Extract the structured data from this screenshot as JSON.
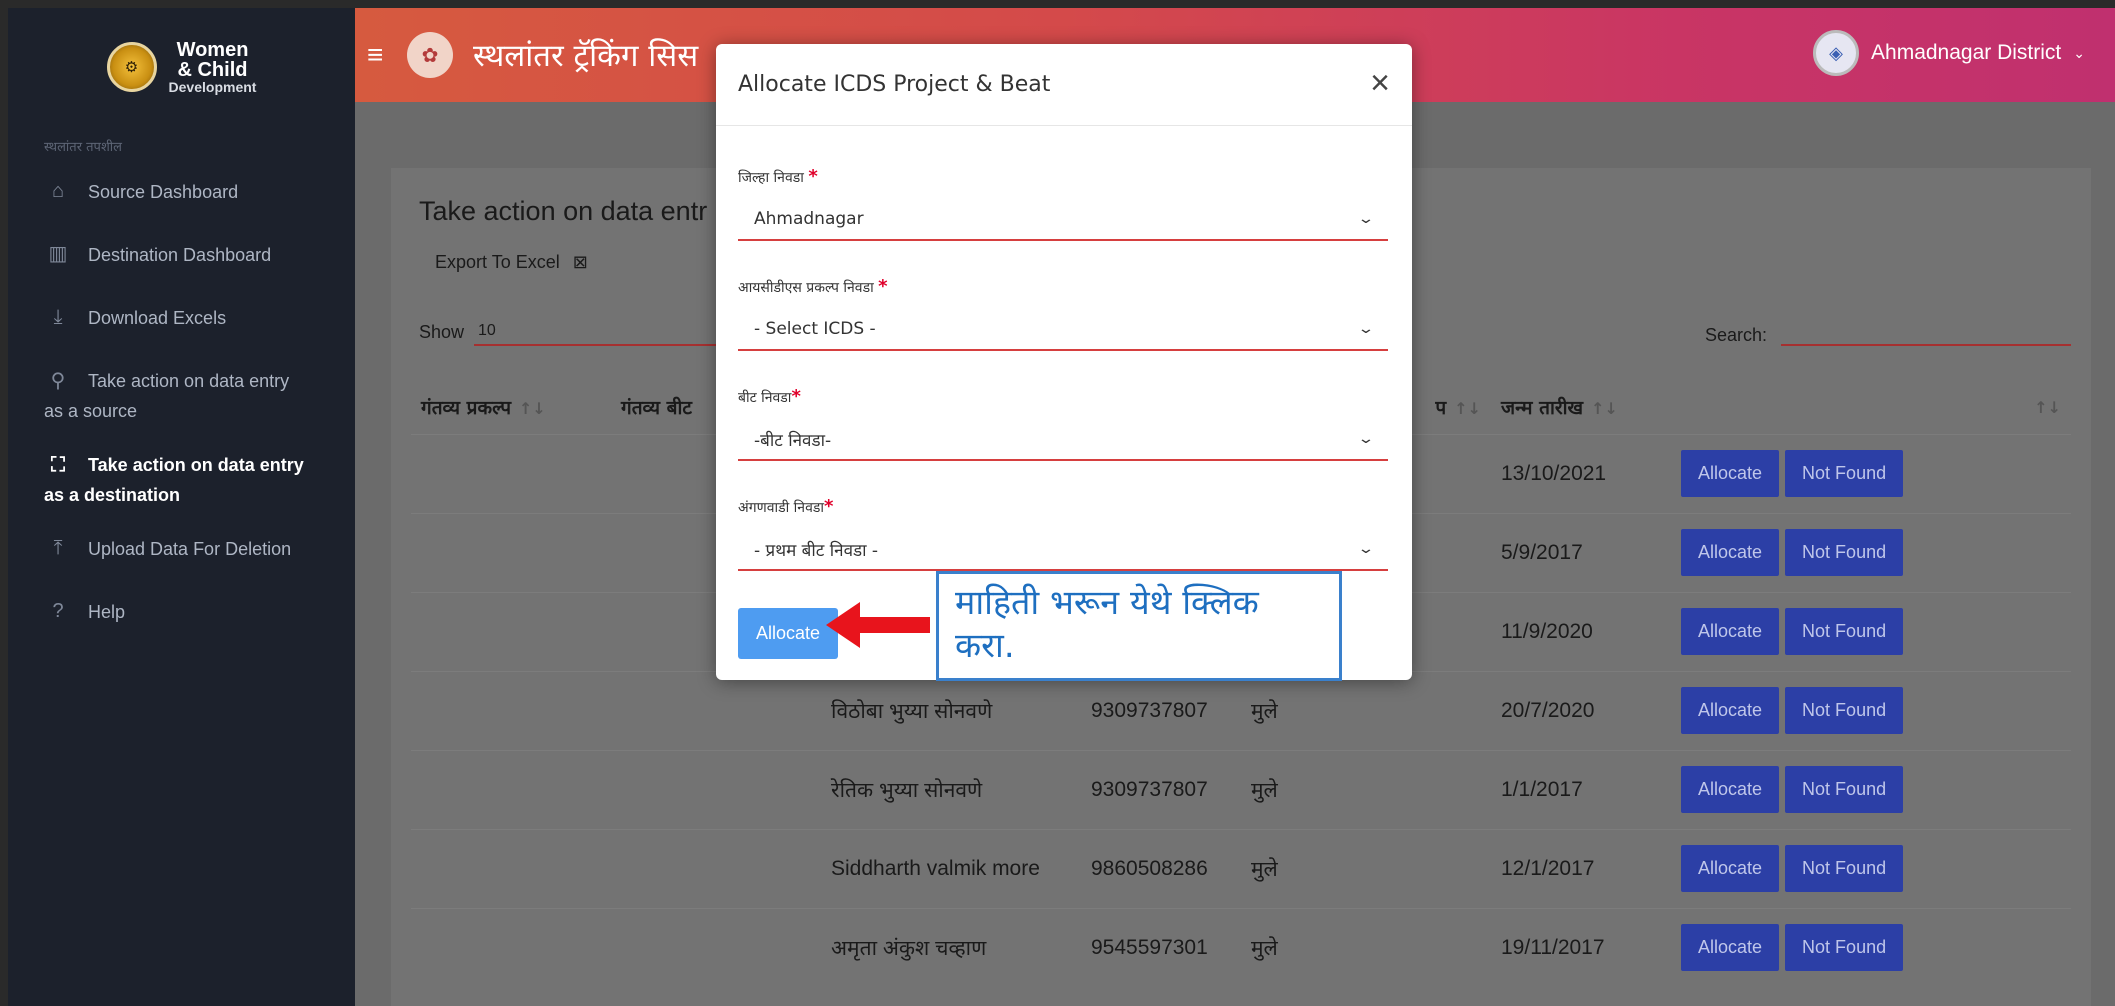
{
  "sidebar": {
    "brand": {
      "line1": "Women",
      "line2": "& Child",
      "line3": "Development"
    },
    "section_label": "स्थलांतर तपशील",
    "items": [
      {
        "label": "Source Dashboard",
        "icon": "home-icon"
      },
      {
        "label": "Destination Dashboard",
        "icon": "map-icon"
      },
      {
        "label": "Download Excels",
        "icon": "download-icon"
      },
      {
        "label": "Take action on data entry",
        "label2": "as a source",
        "icon": "user-search-icon"
      },
      {
        "label": "Take action on data entry",
        "label2": "as a destination",
        "icon": "map-search-icon",
        "active": true
      },
      {
        "label": "Upload Data For Deletion",
        "icon": "upload-icon"
      },
      {
        "label": "Help",
        "icon": "help-icon"
      }
    ]
  },
  "header": {
    "app_title": "स्थलांतर ट्रॅकिंग सिस",
    "district": "Ahmadnagar District"
  },
  "main": {
    "card_title": "Take action on data entr",
    "export_label": "Export To Excel",
    "show_label": "Show",
    "show_value": "10",
    "search_label": "Search:",
    "columns": [
      "गंतव्य प्रकल्प",
      "गंतव्य बीट",
      "प",
      "जन्म तारीख"
    ],
    "rows": [
      {
        "name": "",
        "mobile": "",
        "gender": "",
        "dob": "13/10/2021"
      },
      {
        "name": "",
        "mobile": "",
        "gender": "",
        "dob": "5/9/2017"
      },
      {
        "name": "",
        "mobile": "",
        "gender": "",
        "dob": "11/9/2020"
      },
      {
        "name": "विठोबा भुय्या सोनवणे",
        "mobile": "9309737807",
        "gender": "मुले",
        "dob": "20/7/2020"
      },
      {
        "name": "रेतिक भुय्या सोनवणे",
        "mobile": "9309737807",
        "gender": "मुले",
        "dob": "1/1/2017"
      },
      {
        "name": "Siddharth valmik more",
        "mobile": "9860508286",
        "gender": "मुले",
        "dob": "12/1/2017"
      },
      {
        "name": "अमृता अंकुश चव्हाण",
        "mobile": "9545597301",
        "gender": "मुले",
        "dob": "19/11/2017"
      }
    ],
    "allocate_label": "Allocate",
    "not_found_label": "Not Found"
  },
  "modal": {
    "title": "Allocate ICDS Project & Beat",
    "fields": [
      {
        "label": "जिल्हा निवडा",
        "value": "Ahmadnagar"
      },
      {
        "label": "आयसीडीएस प्रकल्प निवडा",
        "value": "- Select ICDS -"
      },
      {
        "label": "बीट निवडा",
        "value": "-बीट निवडा-"
      },
      {
        "label": "अंगणवाडी निवडा",
        "value": "- प्रथम बीट निवडा -"
      }
    ],
    "required_mark": "*",
    "allocate_label": "Allocate"
  },
  "annotation": {
    "text": "माहिती भरून येथे क्लिक करा.",
    "color": "#1e6fc0",
    "arrow_color": "#e8141c"
  }
}
